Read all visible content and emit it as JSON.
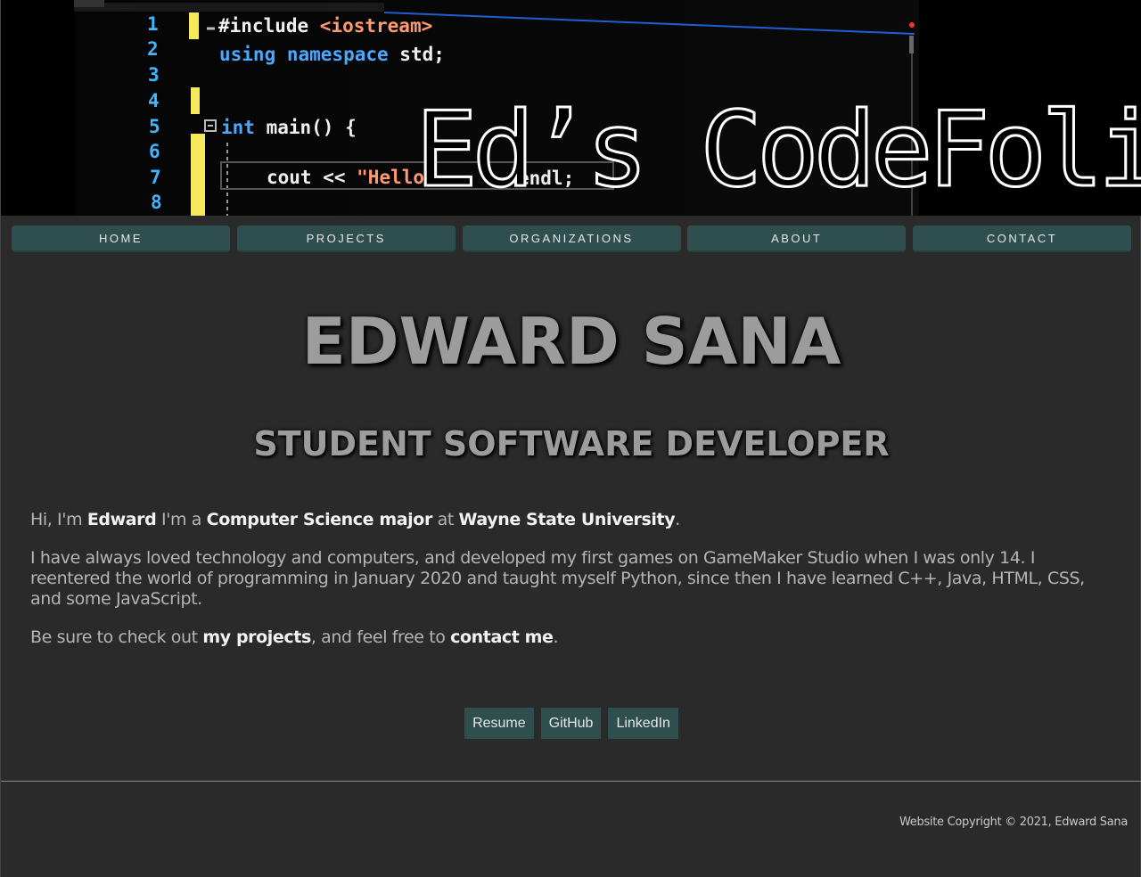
{
  "banner": {
    "title": "Ed’s CodeFolio",
    "code_lines": [
      {
        "num": "1",
        "text": "#include <iostream>"
      },
      {
        "num": "2",
        "text": "using namespace std;"
      },
      {
        "num": "3",
        "text": ""
      },
      {
        "num": "4",
        "text": ""
      },
      {
        "num": "5",
        "text": "int main() {"
      },
      {
        "num": "6",
        "text": ""
      },
      {
        "num": "7",
        "text": "cout << \"Hello   d   endl;"
      },
      {
        "num": "8",
        "text": ""
      }
    ]
  },
  "nav": {
    "items": [
      {
        "label": "HOME"
      },
      {
        "label": "PROJECTS"
      },
      {
        "label": "ORGANIZATIONS"
      },
      {
        "label": "ABOUT"
      },
      {
        "label": "CONTACT"
      }
    ]
  },
  "hero": {
    "name": "EDWARD SANA",
    "subtitle": "STUDENT SOFTWARE DEVELOPER"
  },
  "bio": {
    "p1": {
      "t1": "Hi, I'm ",
      "b1": "Edward",
      "t2": " I'm a ",
      "b2": "Computer Science major",
      "t3": " at ",
      "b3": "Wayne State University",
      "t4": "."
    },
    "p2": "I have always loved technology and computers, and developed my first games on GameMaker Studio when I was only 14. I reentered the world of programming in January 2020 and taught myself Python, since then I have learned C++, Java, HTML, CSS, and some JavaScript.",
    "p3": {
      "t1": "Be sure to check out ",
      "link1": "my projects",
      "t2": ", and feel free to ",
      "link2": "contact me",
      "t3": "."
    }
  },
  "links": {
    "resume": "Resume",
    "github": "GitHub",
    "linkedin": "LinkedIn"
  },
  "footer": {
    "copyright": "Website Copyright © 2021, Edward Sana"
  },
  "colors": {
    "background": "#2a2a2a",
    "button": "#2f4f4f",
    "heading": "#9c9c9c",
    "body_text": "#b5b5b5",
    "code_number": "#3fb6ff",
    "code_keyword": "#4aa8ff",
    "code_string": "#ff9a70"
  }
}
